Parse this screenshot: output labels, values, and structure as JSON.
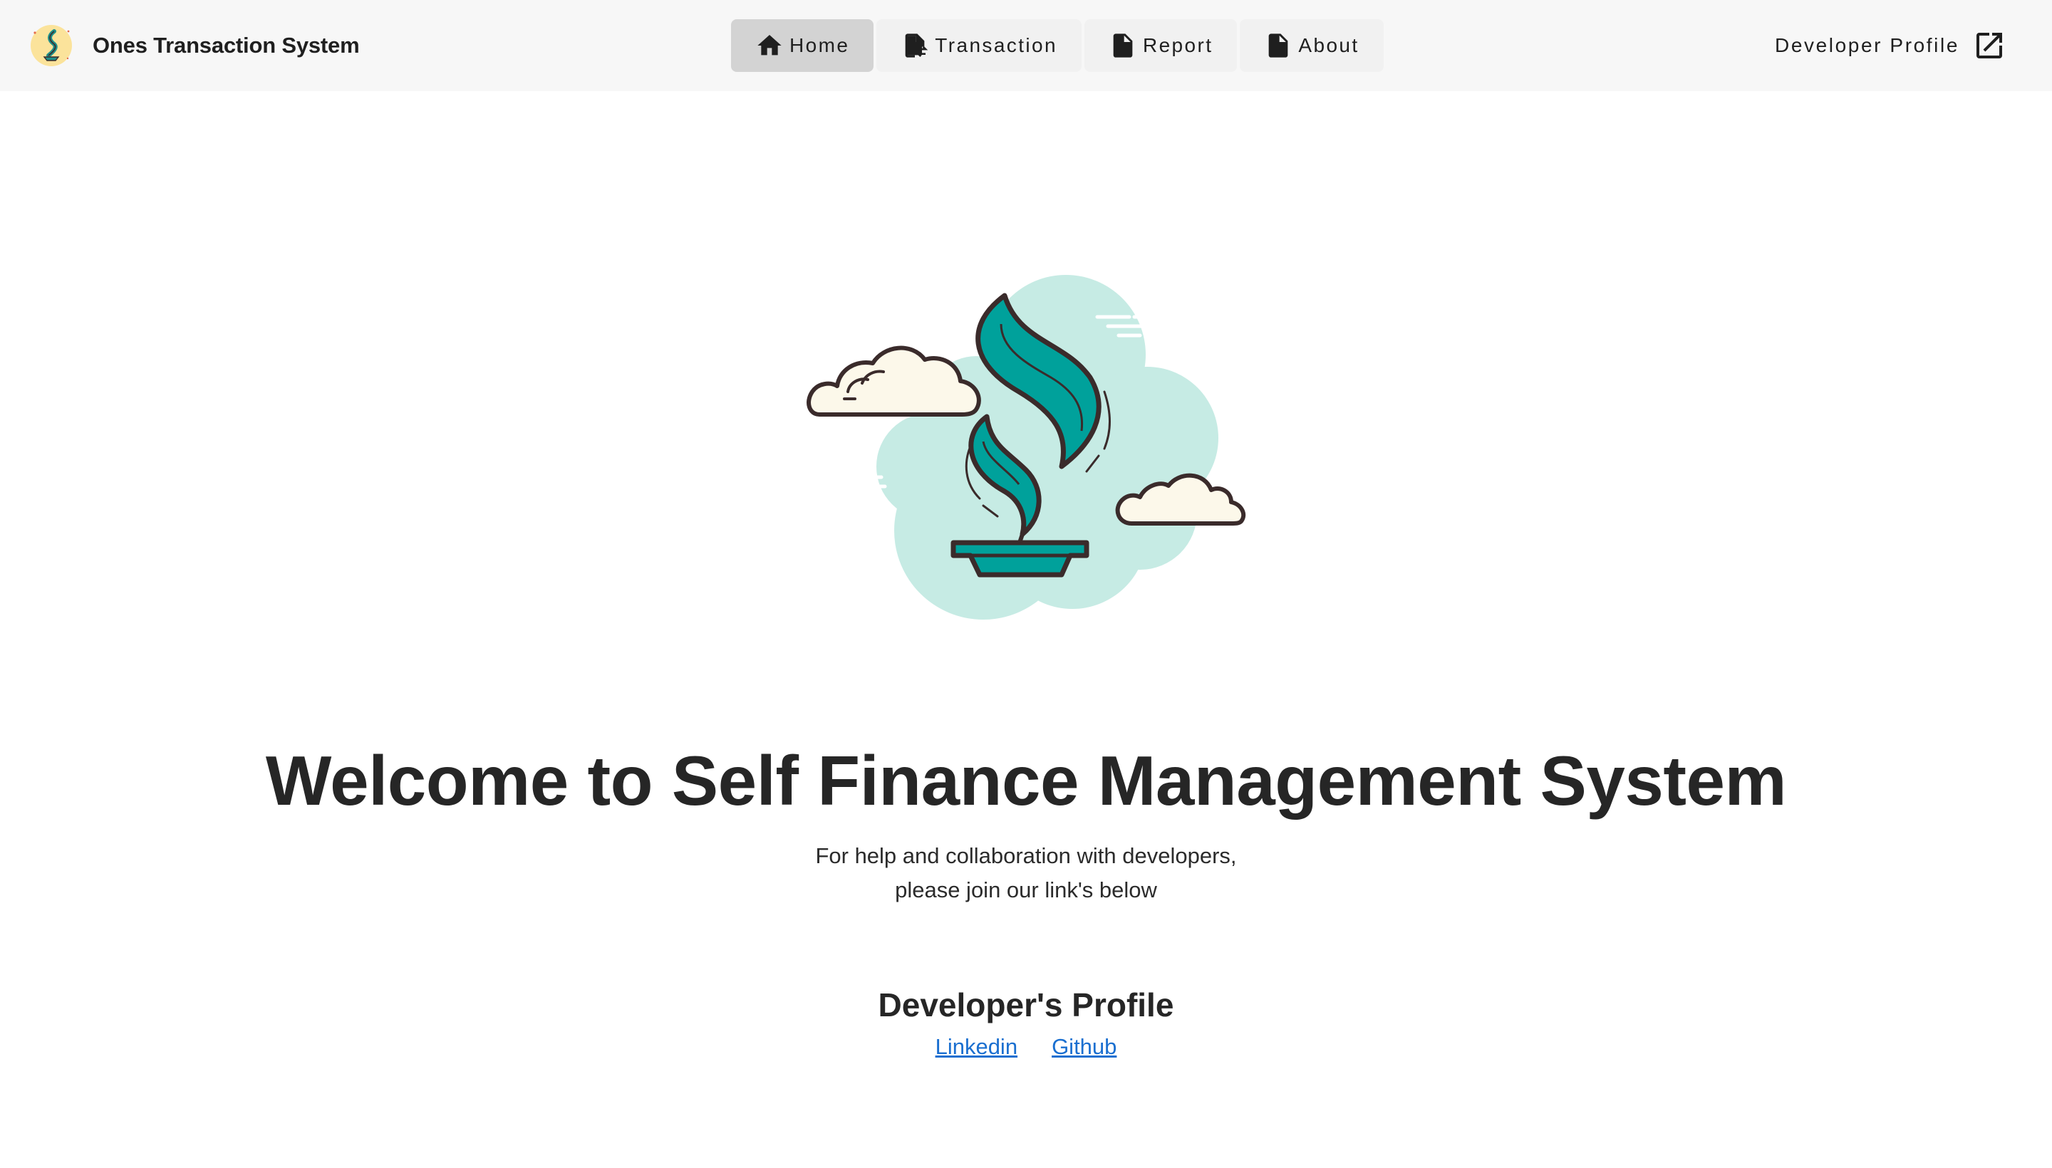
{
  "app": {
    "title": "Ones Transaction System",
    "logo_icon": "dollar-plant-logo-icon"
  },
  "nav": {
    "items": [
      {
        "label": "Home",
        "icon": "home-icon",
        "active": true
      },
      {
        "label": "Transaction",
        "icon": "file-transfer-icon",
        "active": false
      },
      {
        "label": "Report",
        "icon": "document-icon",
        "active": false
      },
      {
        "label": "About",
        "icon": "document-icon",
        "active": false
      }
    ]
  },
  "header_right": {
    "label": "Developer Profile",
    "icon": "open-in-new-icon"
  },
  "hero": {
    "illustration": "dollar-sprout-clouds-illustration",
    "title": "Welcome to Self Finance Management System",
    "subtitle_line1": "For help and collaboration with developers,",
    "subtitle_line2": "please join our link's below"
  },
  "developer": {
    "heading": "Developer's Profile",
    "links": [
      "Linkedin",
      "Github"
    ]
  },
  "colors": {
    "appbar_bg": "#f7f7f7",
    "nav_active_bg": "#d3d3d3",
    "teal": "#00a19b",
    "mint": "#c6ebe4",
    "link": "#1a6fd0",
    "logo_bg": "#fbe39b"
  }
}
